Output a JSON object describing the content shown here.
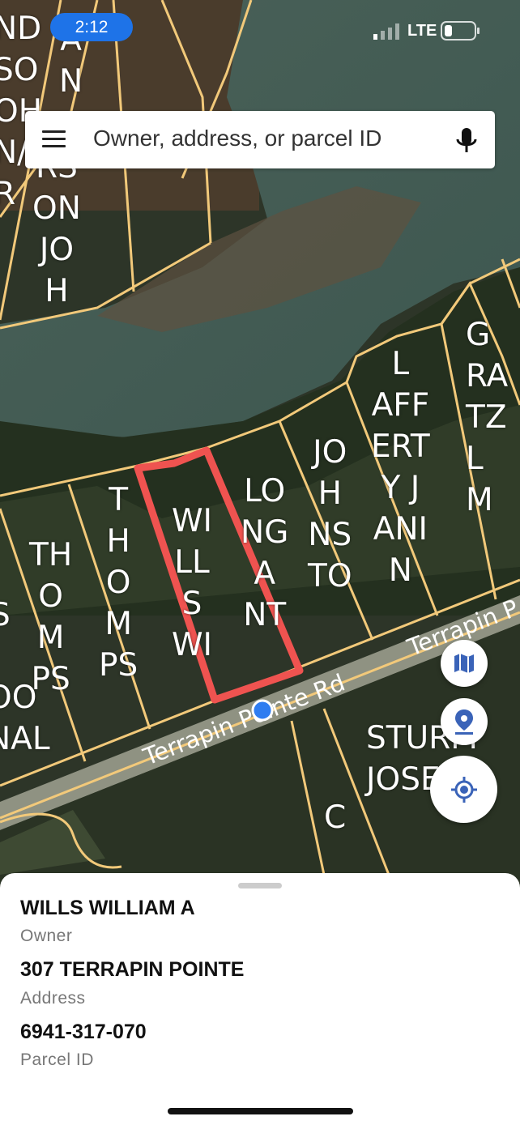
{
  "status_bar": {
    "time": "2:12",
    "network": "LTE"
  },
  "search": {
    "placeholder": "Owner, address, or parcel ID"
  },
  "map": {
    "road_name_1": "Terrapin Pointe Rd",
    "road_name_2": "Terrapin P",
    "parcel_labels": [
      "ND\nSO\nOH\nN/\nR",
      "A\nN",
      "RS\nON\nJO\nH",
      "G\nRA\nTZ\nL\nM",
      "L\nAFF\nERT\nY J\nANI\nN",
      "JO\nH\nNS\nTO",
      "LO\nNG\nA\nNT",
      "WI\nLL\nS\nWI",
      "T\nH\nO\nM\nPS",
      "TH\nO\nM\nPS",
      "I\nS",
      "OO\nNAL",
      "STURM\nJOSEPH",
      "C"
    ]
  },
  "details": {
    "owner_value": "WILLS WILLIAM A",
    "owner_label": "Owner",
    "address_value": "307 TERRAPIN POINTE",
    "address_label": "Address",
    "parcel_value": "6941-317-070",
    "parcel_label": "Parcel ID"
  },
  "colors": {
    "parcel_line": "#f2c97a",
    "selected_parcel": "#ef5350",
    "accent": "#1e73e8",
    "fab_icon": "#3a63b8"
  },
  "icons": [
    "menu-icon",
    "microphone-icon",
    "map-layers-icon",
    "pin-icon",
    "locate-icon"
  ]
}
